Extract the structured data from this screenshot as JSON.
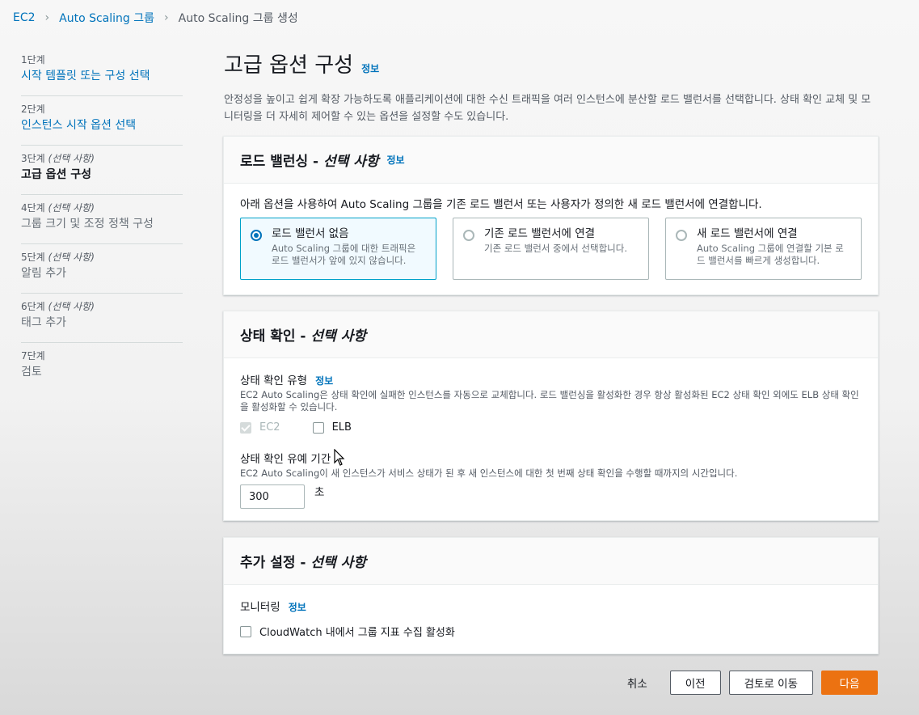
{
  "breadcrumb": {
    "items": [
      "EC2",
      "Auto Scaling 그룹",
      "Auto Scaling 그룹 생성"
    ]
  },
  "sidebar": {
    "steps": [
      {
        "num": "1단계",
        "optional": "",
        "label": "시작 템플릿 또는 구성 선택",
        "state": "link"
      },
      {
        "num": "2단계",
        "optional": "",
        "label": "인스턴스 시작 옵션 선택",
        "state": "link"
      },
      {
        "num": "3단계",
        "optional": "(선택 사항)",
        "label": "고급 옵션 구성",
        "state": "current"
      },
      {
        "num": "4단계",
        "optional": "(선택 사항)",
        "label": "그룹 크기 및 조정 정책 구성",
        "state": "disabled"
      },
      {
        "num": "5단계",
        "optional": "(선택 사항)",
        "label": "알림 추가",
        "state": "disabled"
      },
      {
        "num": "6단계",
        "optional": "(선택 사항)",
        "label": "태그 추가",
        "state": "disabled"
      },
      {
        "num": "7단계",
        "optional": "",
        "label": "검토",
        "state": "disabled"
      }
    ]
  },
  "page": {
    "title": "고급 옵션 구성",
    "info": "정보",
    "intro": "안정성을 높이고 쉽게 확장 가능하도록 애플리케이션에 대한 수신 트래픽을 여러 인스턴스에 분산할 로드 밸런서를 선택합니다. 상태 확인 교체 및 모니터링을 더 자세히 제어할 수 있는 옵션을 설정할 수도 있습니다."
  },
  "load_balancing": {
    "title": "로드 밸런싱 - ",
    "optional": "선택 사항",
    "info": "정보",
    "description": "아래 옵션을 사용하여 Auto Scaling 그룹을 기존 로드 밸런서 또는 사용자가 정의한 새 로드 밸런서에 연결합니다.",
    "options": [
      {
        "title": "로드 밸런서 없음",
        "desc": "Auto Scaling 그룹에 대한 트래픽은 로드 밸런서가 앞에 있지 않습니다.",
        "selected": true
      },
      {
        "title": "기존 로드 밸런서에 연결",
        "desc": "기존 로드 밸런서 중에서 선택합니다.",
        "selected": false
      },
      {
        "title": "새 로드 밸런서에 연결",
        "desc": "Auto Scaling 그룹에 연결할 기본 로드 밸런서를 빠르게 생성합니다.",
        "selected": false
      }
    ]
  },
  "health_check": {
    "title": "상태 확인 - ",
    "optional": "선택 사항",
    "type_label": "상태 확인 유형",
    "info": "정보",
    "type_desc": "EC2 Auto Scaling은 상태 확인에 실패한 인스턴스를 자동으로 교체합니다. 로드 밸런싱을 활성화한 경우 항상 활성화된 EC2 상태 확인 외에도 ELB 상태 확인을 활성화할 수 있습니다.",
    "ec2_label": "EC2",
    "elb_label": "ELB",
    "grace_label": "상태 확인 유예 기간",
    "grace_desc": "EC2 Auto Scaling이 새 인스턴스가 서비스 상태가 된 후 새 인스턴스에 대한 첫 번째 상태 확인을 수행할 때까지의 시간입니다.",
    "grace_value": "300",
    "grace_unit": "초"
  },
  "additional": {
    "title": "추가 설정 - ",
    "optional": "선택 사항",
    "monitoring_label": "모니터링",
    "info": "정보",
    "cloudwatch_label": "CloudWatch 내에서 그룹 지표 수집 활성화"
  },
  "footer": {
    "cancel": "취소",
    "previous": "이전",
    "skip_to_review": "검토로 이동",
    "next": "다음"
  }
}
